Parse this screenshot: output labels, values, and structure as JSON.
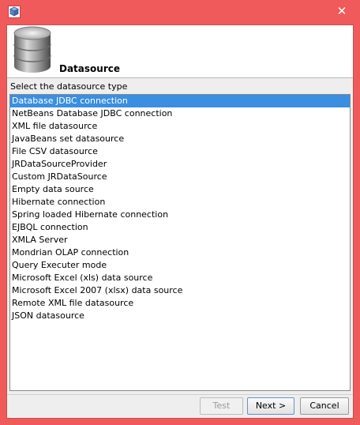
{
  "window": {
    "close_glyph": "✕",
    "accent_color": "#f05a5a"
  },
  "header": {
    "title": "Datasource",
    "icon": "database-icon"
  },
  "prompt": "Select the datasource type",
  "datasource_types": [
    {
      "label": "Database JDBC connection",
      "selected": true
    },
    {
      "label": "NetBeans Database JDBC connection",
      "selected": false
    },
    {
      "label": "XML file datasource",
      "selected": false
    },
    {
      "label": "JavaBeans set datasource",
      "selected": false
    },
    {
      "label": "File CSV datasource",
      "selected": false
    },
    {
      "label": "JRDataSourceProvider",
      "selected": false
    },
    {
      "label": "Custom JRDataSource",
      "selected": false
    },
    {
      "label": "Empty data source",
      "selected": false
    },
    {
      "label": "Hibernate connection",
      "selected": false
    },
    {
      "label": "Spring loaded Hibernate connection",
      "selected": false
    },
    {
      "label": "EJBQL connection",
      "selected": false
    },
    {
      "label": "XMLA Server",
      "selected": false
    },
    {
      "label": "Mondrian OLAP connection",
      "selected": false
    },
    {
      "label": "Query Executer mode",
      "selected": false
    },
    {
      "label": "Microsoft Excel (xls) data source",
      "selected": false
    },
    {
      "label": "Microsoft Excel 2007 (xlsx) data source",
      "selected": false
    },
    {
      "label": "Remote XML file datasource",
      "selected": false
    },
    {
      "label": "JSON datasource",
      "selected": false
    }
  ],
  "buttons": {
    "test": "Test",
    "next": "Next >",
    "cancel": "Cancel"
  },
  "colors": {
    "selection": "#3a8fe0"
  }
}
